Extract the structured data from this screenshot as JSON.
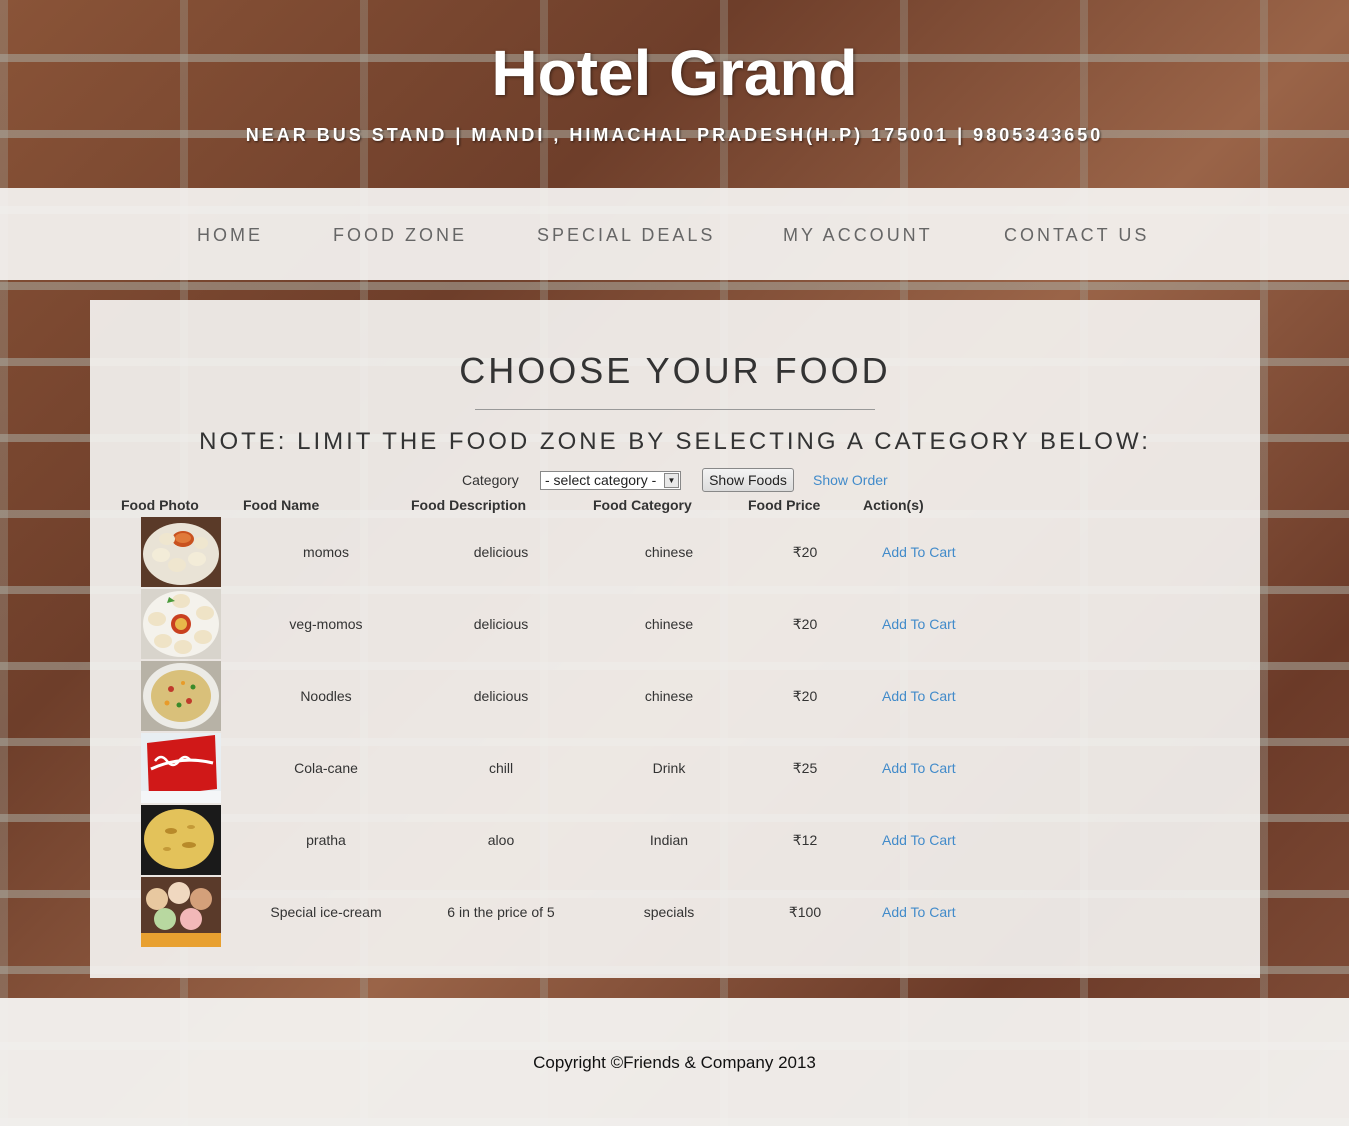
{
  "header": {
    "title": "Hotel Grand",
    "address": "NEAR BUS STAND | MANDI , HIMACHAL PRADESH(H.P) 175001 | 9805343650"
  },
  "nav": {
    "items": [
      {
        "label": "HOME"
      },
      {
        "label": "FOOD ZONE"
      },
      {
        "label": "SPECIAL DEALS"
      },
      {
        "label": "MY ACCOUNT"
      },
      {
        "label": "CONTACT US"
      }
    ]
  },
  "main": {
    "title": "CHOOSE YOUR FOOD",
    "note": "NOTE: LIMIT THE FOOD ZONE BY SELECTING A CATEGORY BELOW:",
    "filter": {
      "label": "Category",
      "select_value": "- select category -",
      "button_label": "Show Foods",
      "show_order_label": "Show Order"
    },
    "table": {
      "headers": [
        "Food Photo",
        "Food Name",
        "Food Description",
        "Food Category",
        "Food Price",
        "Action(s)"
      ],
      "rows": [
        {
          "photo": "momos-photo",
          "name": "momos",
          "description": "delicious",
          "category": "chinese",
          "price": "₹20",
          "action": "Add To Cart"
        },
        {
          "photo": "veg-momos-photo",
          "name": "veg-momos",
          "description": "delicious",
          "category": "chinese",
          "price": "₹20",
          "action": "Add To Cart"
        },
        {
          "photo": "noodles-photo",
          "name": "Noodles",
          "description": "delicious",
          "category": "chinese",
          "price": "₹20",
          "action": "Add To Cart"
        },
        {
          "photo": "cola-photo",
          "name": "Cola-cane",
          "description": "chill",
          "category": "Drink",
          "price": "₹25",
          "action": "Add To Cart"
        },
        {
          "photo": "pratha-photo",
          "name": "pratha",
          "description": "aloo",
          "category": "Indian",
          "price": "₹12",
          "action": "Add To Cart"
        },
        {
          "photo": "ice-cream-photo",
          "name": "Special ice-cream",
          "description": "6 in the price of 5",
          "category": "specials",
          "price": "₹100",
          "action": "Add To Cart"
        }
      ]
    }
  },
  "footer": {
    "copyright": "Copyright ©Friends & Company 2013"
  },
  "colors": {
    "link": "#428bca",
    "text": "#333333",
    "nav_text": "#666666"
  }
}
